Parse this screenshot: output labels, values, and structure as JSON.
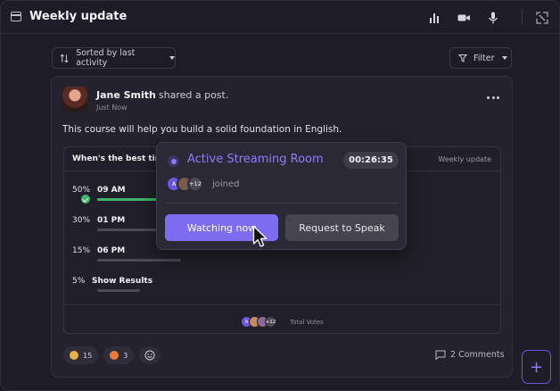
{
  "window": {
    "title": "Weekly update"
  },
  "toolbar": {
    "icons": [
      "bar-chart-icon",
      "video-camera-icon",
      "microphone-icon",
      "picture-in-picture-icon"
    ]
  },
  "controls": {
    "sort_label": "Sorted by last activity",
    "filter_label": "Filter"
  },
  "post": {
    "author": "Jane Smith",
    "action": "shared a post.",
    "time": "Just Now",
    "text": "This course will help you build a solid foundation in English."
  },
  "poll": {
    "question": "When's the best time",
    "tag": "Weekly update",
    "options": [
      {
        "percent": "50%",
        "label": "09 AM",
        "value": 0.5,
        "selected": true
      },
      {
        "percent": "30%",
        "label": "01 PM",
        "value": 0.3,
        "selected": false
      },
      {
        "percent": "15%",
        "label": "06 PM",
        "value": 0.15,
        "selected": false
      },
      {
        "percent": "5%",
        "label": "Show Results",
        "value": 0.05,
        "selected": false
      }
    ],
    "voters": [
      {
        "initial": "A",
        "color": "#6a56e0"
      },
      {
        "initial": "",
        "color": "#c98a5a"
      },
      {
        "initial": "",
        "color": "#8a6a9a"
      },
      {
        "initial": "+12",
        "color": "#4a4956"
      }
    ],
    "total_votes_label": "Total Votes"
  },
  "reactions": [
    {
      "emoji": "party-popper-icon",
      "count": "15",
      "color": "#e9b24a"
    },
    {
      "emoji": "fire-icon",
      "count": "3",
      "color": "#f07a3a"
    }
  ],
  "comments_label": "2 Comments",
  "popover": {
    "title": "Active Streaming Room",
    "timer": "00:26:35",
    "joined_avatars": [
      {
        "initial": "A",
        "color": "#6a56e0"
      },
      {
        "initial": "",
        "color": "#7a5a4a"
      },
      {
        "initial": "+12",
        "color": "#4a4956"
      }
    ],
    "joined_label": "joined",
    "watch_label": "Watching now",
    "speak_label": "Request to Speak"
  },
  "colors": {
    "accent": "#7d6bf0",
    "success": "#3fb56a",
    "background": "#1e1d27"
  }
}
